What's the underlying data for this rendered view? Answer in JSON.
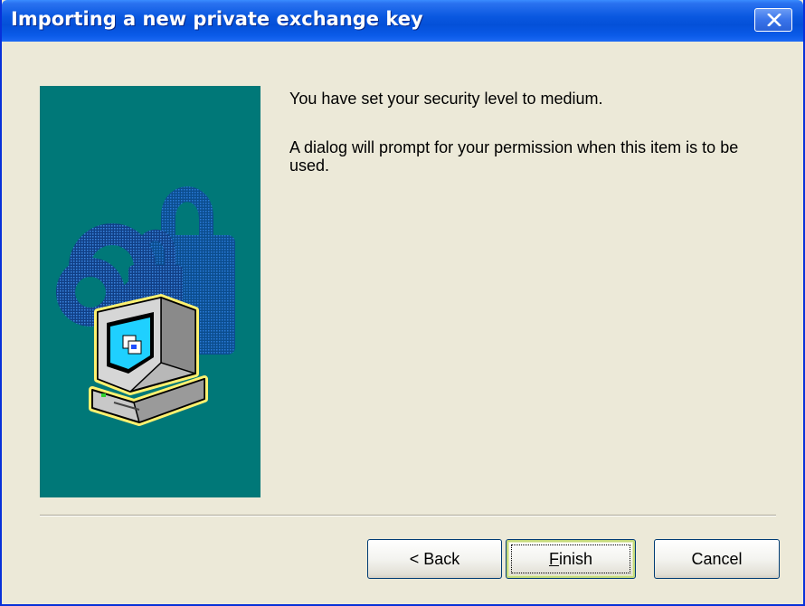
{
  "window": {
    "title": "Importing a new private exchange key",
    "close_icon": "close-icon"
  },
  "content": {
    "message_line1": "You have set your security level to medium.",
    "message_line2": "A dialog will prompt for your permission when this item is to be used."
  },
  "illustration": {
    "icon": "computer-with-padlocks-icon",
    "background_color": "#007878"
  },
  "buttons": {
    "back_label": "< Back",
    "finish_label_mnemonic": "F",
    "finish_label_rest": "inish",
    "cancel_label": "Cancel",
    "default_button": "Finish"
  },
  "colors": {
    "titlebar": "#0a58e0",
    "dialog_bg": "#ece9d8",
    "panel_teal": "#007878"
  }
}
